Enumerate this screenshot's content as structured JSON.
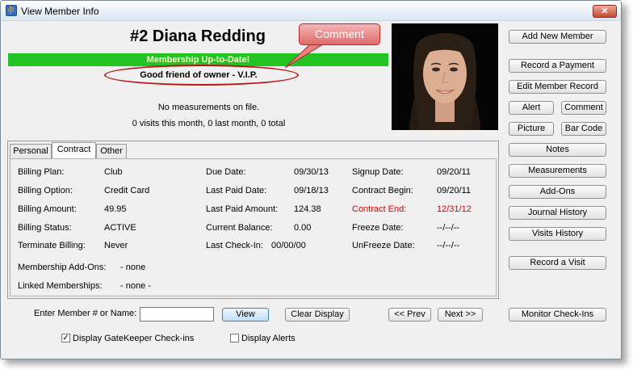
{
  "window": {
    "title": "View Member Info",
    "close_glyph": "✕"
  },
  "member": {
    "title": "#2  Diana Redding",
    "status_bar": "Membership Up-to-Date!",
    "comment_text": "Good friend of owner - V.I.P.",
    "callout": "Comment",
    "measurements": "No measurements on file.",
    "visits": "0 visits this month, 0 last month, 0 total"
  },
  "colors": {
    "status_green": "#22c322",
    "accent_red": "#b8171a",
    "contract_end_red": "#e00000"
  },
  "right_buttons": {
    "add_new_member": "Add New Member",
    "record_payment": "Record a Payment",
    "edit_member": "Edit Member Record",
    "alert": "Alert",
    "comment": "Comment",
    "picture": "Picture",
    "bar_code": "Bar Code",
    "notes": "Notes",
    "measurements": "Measurements",
    "add_ons": "Add-Ons",
    "journal_history": "Journal History",
    "visits_history": "Visits History",
    "record_visit": "Record a Visit",
    "monitor_checkins": "Monitor Check-Ins"
  },
  "tabs": [
    {
      "label": "Personal"
    },
    {
      "label": "Contract"
    },
    {
      "label": "Other"
    }
  ],
  "contract": {
    "billing_plan_label": "Billing Plan:",
    "billing_plan": "Club",
    "billing_option_label": "Billing Option:",
    "billing_option": "Credit Card",
    "billing_amount_label": "Billing Amount:",
    "billing_amount": "49.95",
    "billing_status_label": "Billing Status:",
    "billing_status": "ACTIVE",
    "terminate_label": "Terminate Billing:",
    "terminate": "Never",
    "due_date_label": "Due Date:",
    "due_date": "09/30/13",
    "last_paid_date_label": "Last Paid Date:",
    "last_paid_date": "09/18/13",
    "last_paid_amount_label": "Last Paid Amount:",
    "last_paid_amount": "124.38",
    "current_balance_label": "Current Balance:",
    "current_balance": "0.00",
    "last_checkin_label": "Last Check-In:",
    "last_checkin": "00/00/00",
    "signup_date_label": "Signup Date:",
    "signup_date": "09/20/11",
    "contract_begin_label": "Contract Begin:",
    "contract_begin": "09/20/11",
    "contract_end_label": "Contract End:",
    "contract_end": "12/31/12",
    "freeze_label": "Freeze Date:",
    "freeze": "--/--/--",
    "unfreeze_label": "UnFreeze Date:",
    "unfreeze": "--/--/--",
    "addons_label": "Membership Add-Ons:",
    "addons": "- none",
    "linked_label": "Linked Memberships:",
    "linked": "- none -"
  },
  "bottom": {
    "enter_label": "Enter Member # or Name:",
    "search_value": "",
    "view": "View",
    "clear": "Clear Display",
    "prev": "<< Prev",
    "next": "Next >>",
    "gatekeeper_label": "Display GateKeeper Check-ins",
    "gatekeeper_checked": true,
    "alerts_label": "Display Alerts",
    "alerts_checked": false,
    "check_glyph": "✓"
  }
}
